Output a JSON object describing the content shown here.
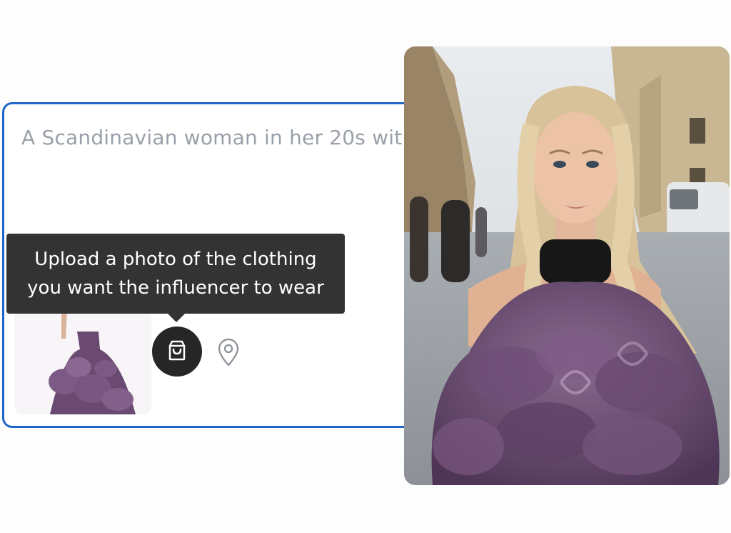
{
  "prompt": {
    "text": "A Scandinavian woman in her 20s wit"
  },
  "tooltip": {
    "line1": "Upload a photo of the clothing",
    "line2": "you want the influencer to wear"
  },
  "icons": {
    "upload": "shopping-bag-icon",
    "location": "map-pin-icon"
  },
  "colors": {
    "card_border": "#1f66c9",
    "tooltip_bg": "#333333",
    "button_bg": "#262626",
    "dress": "#6b4a72"
  }
}
